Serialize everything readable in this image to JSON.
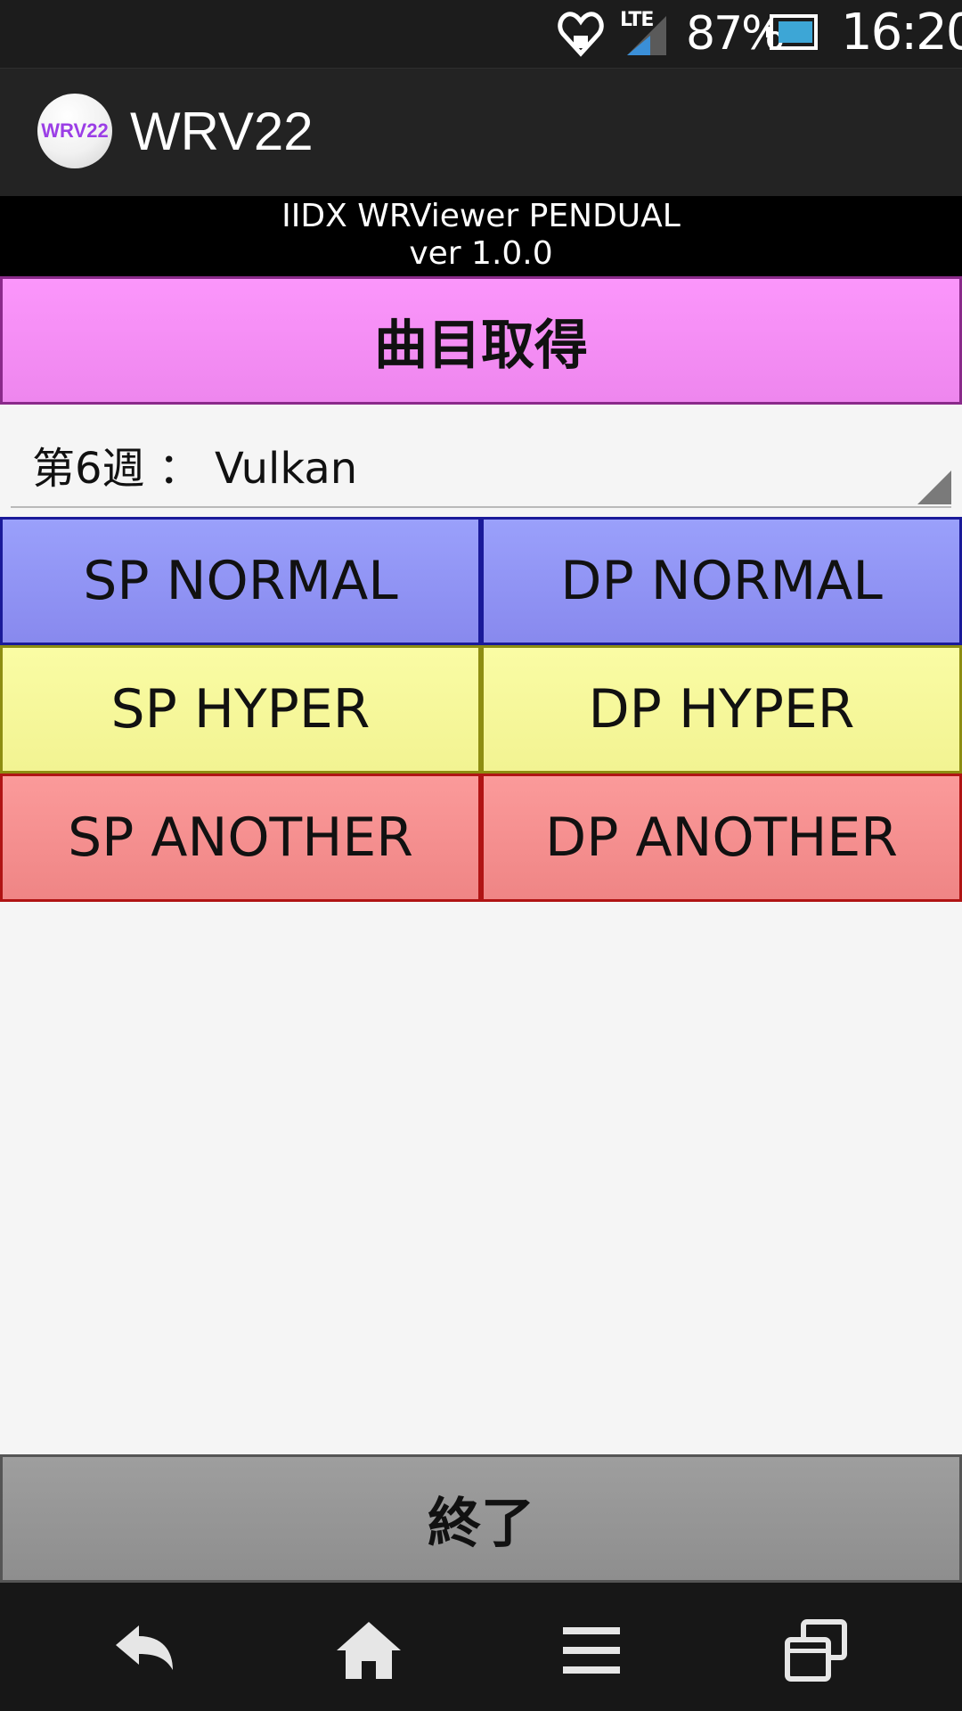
{
  "status_bar": {
    "battery_percent": "87%",
    "time": "16:20",
    "network_label": "LTE",
    "icons": [
      "heart-notification-icon",
      "signal-icon",
      "battery-icon"
    ]
  },
  "app_bar": {
    "logo_text": "WRV22",
    "title": "WRV22"
  },
  "banner": {
    "line1": "IIDX WRViewer PENDUAL",
    "line2": "ver 1.0.0"
  },
  "fetch_button": {
    "label": "曲目取得",
    "color": "#f58ef5"
  },
  "week_select": {
    "selected": "第6週 ： Vulkan"
  },
  "difficulty_buttons": [
    {
      "label": "SP NORMAL",
      "color": "#9094f5"
    },
    {
      "label": "DP NORMAL",
      "color": "#9094f5"
    },
    {
      "label": "SP HYPER",
      "color": "#f7f89b"
    },
    {
      "label": "DP HYPER",
      "color": "#f7f89b"
    },
    {
      "label": "SP ANOTHER",
      "color": "#f58f8f"
    },
    {
      "label": "DP ANOTHER",
      "color": "#f58f8f"
    }
  ],
  "exit_button": {
    "label": "終了",
    "color": "#979797"
  },
  "nav_bar": {
    "icons": [
      "back-icon",
      "home-icon",
      "menu-icon",
      "recents-icon"
    ]
  }
}
